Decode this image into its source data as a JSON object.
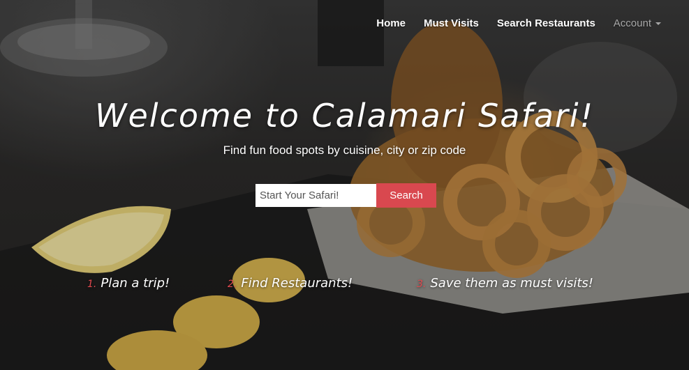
{
  "nav": {
    "home": "Home",
    "must_visits": "Must Visits",
    "search_restaurants": "Search Restaurants",
    "account": "Account"
  },
  "hero": {
    "title": "Welcome to Calamari Safari!",
    "subtitle": "Find fun food spots by cuisine, city or zip code"
  },
  "search": {
    "placeholder": "Start Your Safari!",
    "value": "",
    "button_label": "Search"
  },
  "steps": [
    {
      "number": "1.",
      "text": "Plan a trip!"
    },
    {
      "number": "2.",
      "text": "Find Restaurants!"
    },
    {
      "number": "3.",
      "text": "Save them as must visits!"
    }
  ],
  "colors": {
    "accent": "#d9484f",
    "nav_muted": "#a7a7a7",
    "text": "#ffffff"
  },
  "icons": {
    "account_dropdown": "caret-down-icon"
  }
}
